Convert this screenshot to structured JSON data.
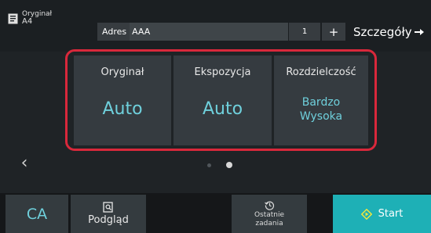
{
  "header": {
    "original_label": "Oryginał",
    "original_size": "A4",
    "address_label": "Adres",
    "address_value": "AAA",
    "copies": "1",
    "plus_label": "+",
    "details_label": "Szczegóły"
  },
  "settings": [
    {
      "label": "Oryginał",
      "value": "Auto"
    },
    {
      "label": "Ekspozycja",
      "value": "Auto"
    },
    {
      "label": "Rozdzielczość",
      "value_line1": "Bardzo",
      "value_line2": "Wysoka"
    }
  ],
  "pager": {
    "prev_label": "‹",
    "page_count": 2,
    "current_page": 2
  },
  "footer": {
    "ca_label": "CA",
    "preview_label": "Podgląd",
    "recent_line1": "Ostatnie",
    "recent_line2": "zadania",
    "start_label": "Start"
  },
  "colors": {
    "accent": "#6fd0dc",
    "highlight": "#d9283b",
    "start": "#1eb0b6",
    "background": "#1f2326",
    "tile": "#353b40"
  },
  "icons": [
    "document-icon",
    "arrow-right-icon",
    "chevron-left-icon",
    "preview-icon",
    "history-icon",
    "start-diamond-icon"
  ]
}
